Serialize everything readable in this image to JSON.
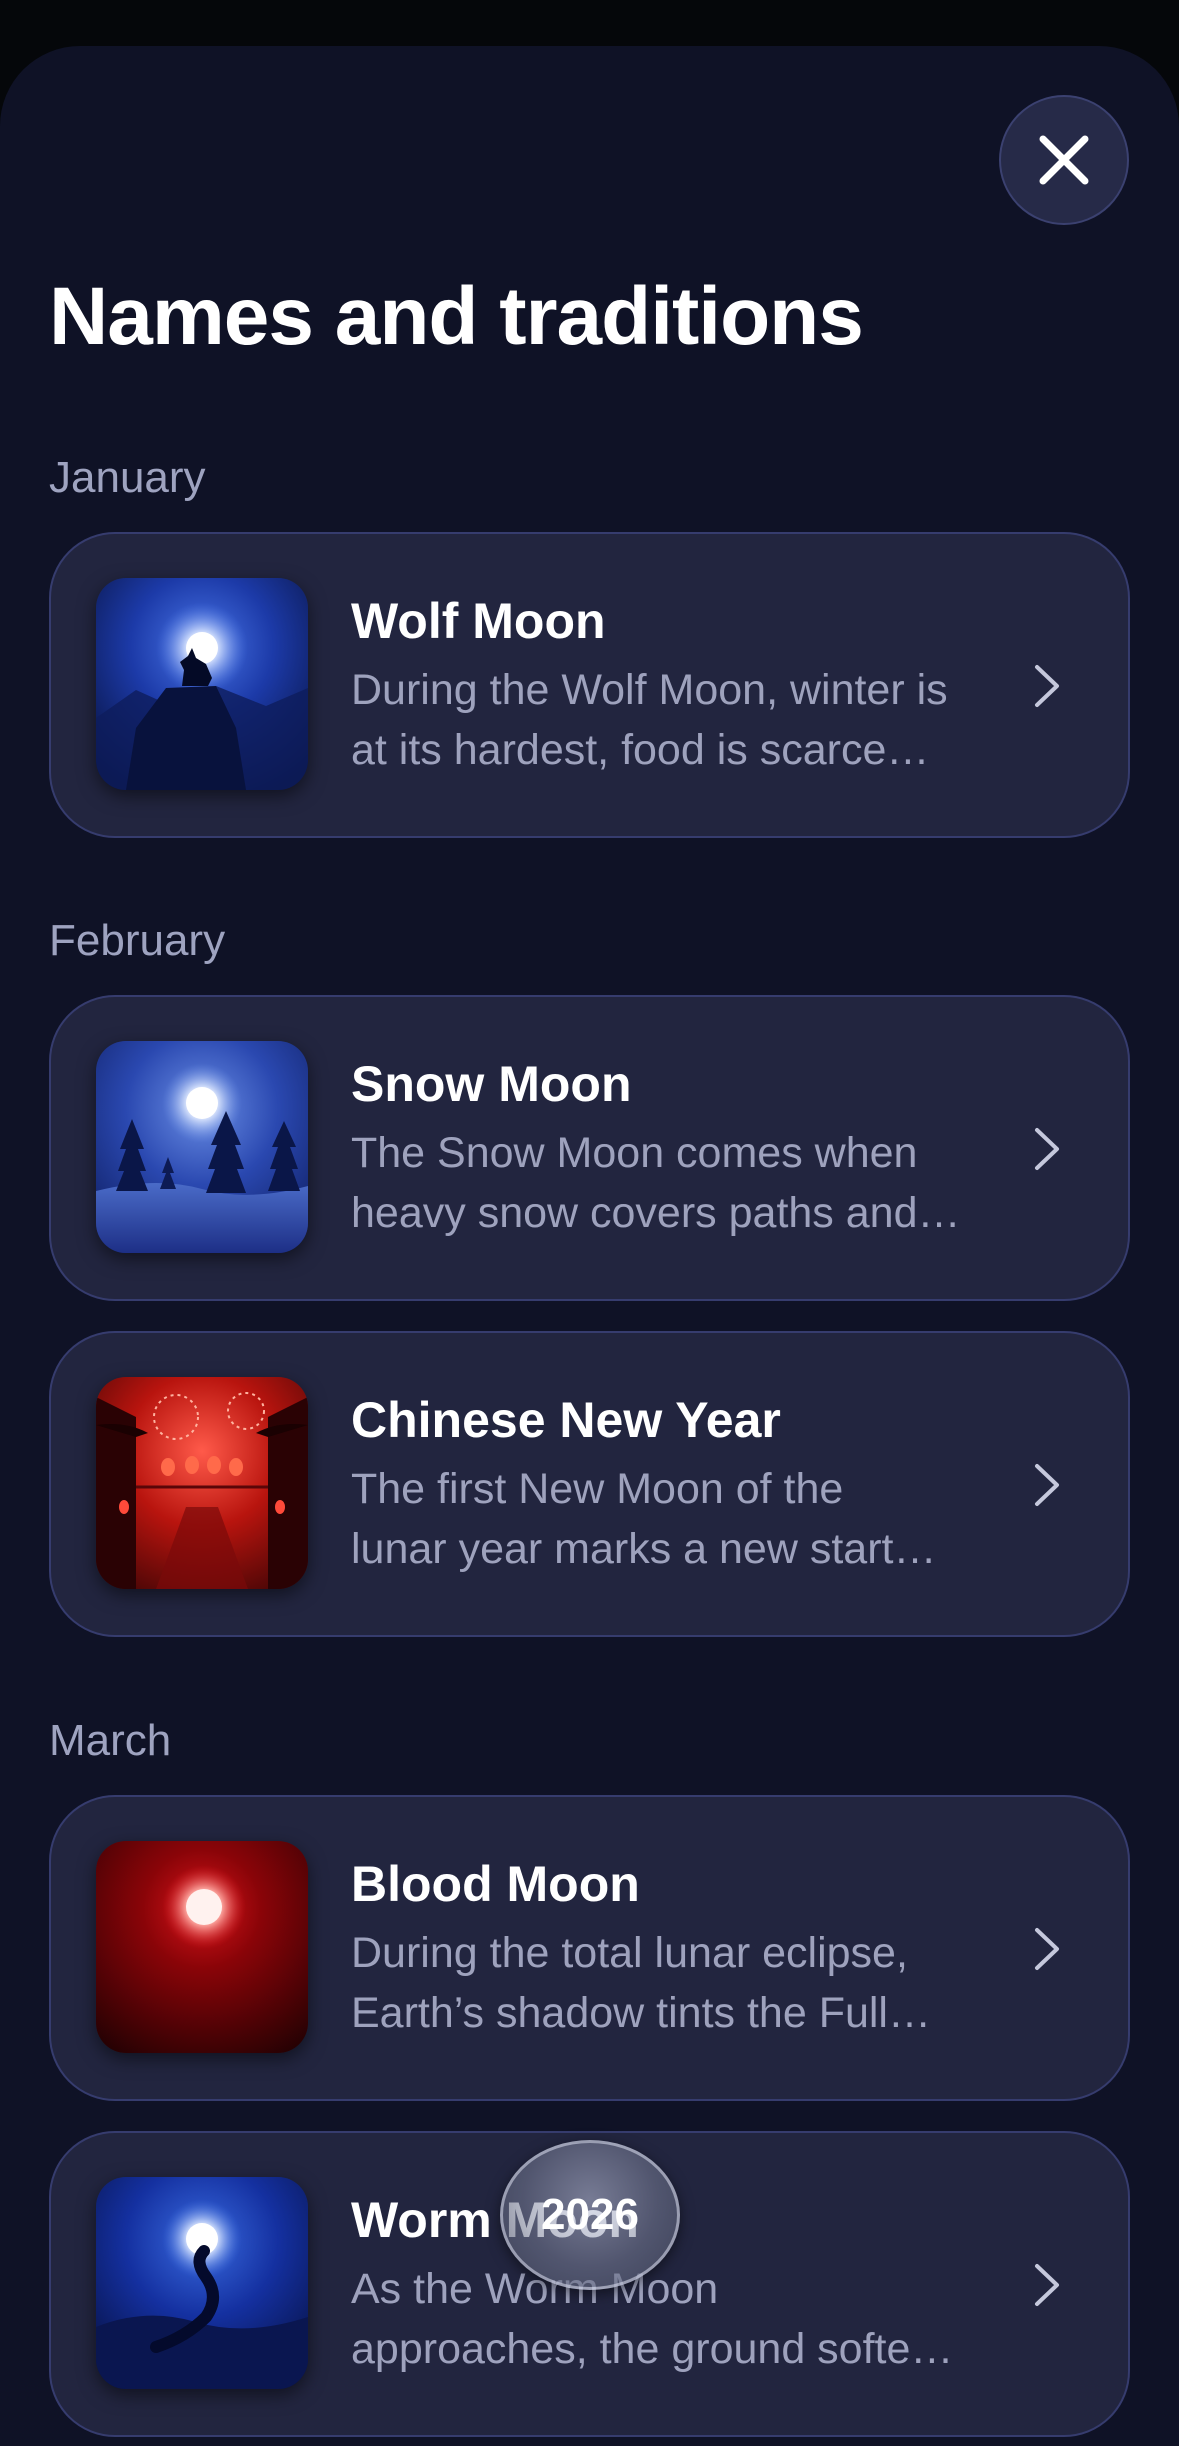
{
  "header": {
    "title": "Names and traditions",
    "close_icon": "close-icon"
  },
  "sections": [
    {
      "month": "January",
      "items": [
        {
          "title": "Wolf Moon",
          "desc_line1": "During the Wolf Moon, winter is",
          "desc_line2": "at its hardest, food is scarce…",
          "image": "wolf-howling-moon"
        }
      ]
    },
    {
      "month": "February",
      "items": [
        {
          "title": "Snow Moon",
          "desc_line1": "The Snow Moon comes when",
          "desc_line2": "heavy snow covers paths and…",
          "image": "snowy-forest-moon"
        },
        {
          "title": "Chinese New Year",
          "desc_line1": "The first New Moon of the",
          "desc_line2": "lunar year marks a new start…",
          "image": "red-lanterns-fireworks"
        }
      ]
    },
    {
      "month": "March",
      "items": [
        {
          "title": "Blood Moon",
          "desc_line1": "During the total lunar eclipse,",
          "desc_line2": "Earth’s shadow tints the Full…",
          "image": "red-blood-moon"
        },
        {
          "title": "Worm Moon",
          "desc_line1": "As the Worm Moon",
          "desc_line2": "approaches, the ground softe…",
          "image": "worm-under-moon"
        }
      ]
    }
  ],
  "year_selector": {
    "label": "2026"
  },
  "colors": {
    "sheet_background": "#0f1226",
    "card_background": "#22253f",
    "card_border": "#363c6e",
    "title_text": "#ffffff",
    "muted_text": "#9ea2bd"
  }
}
